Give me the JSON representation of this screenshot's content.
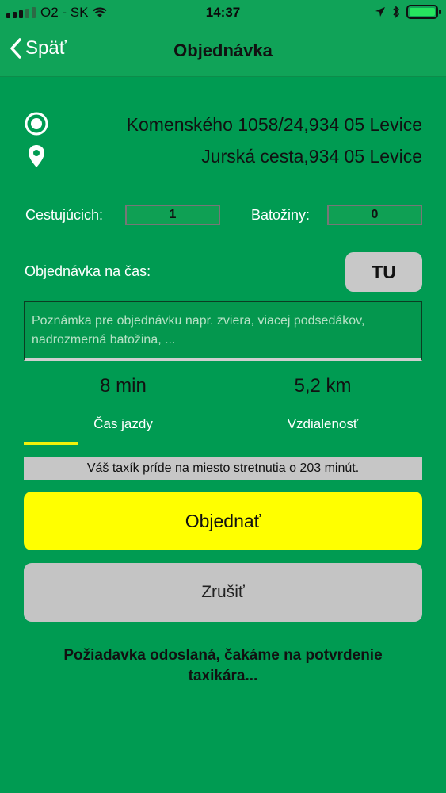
{
  "status_bar": {
    "carrier": "O2 - SK",
    "time": "14:37"
  },
  "nav": {
    "back_label": "Späť",
    "title": "Objednávka"
  },
  "route": {
    "from": "Komenského 1058/24,934 05 Levice",
    "to": "Jurská cesta,934 05 Levice"
  },
  "counts": {
    "passengers_label": "Cestujúcich:",
    "passengers_value": "1",
    "luggage_label": "Batožiny:",
    "luggage_value": "0"
  },
  "time_order": {
    "label": "Objednávka na čas:",
    "button": "TU"
  },
  "note": {
    "placeholder": "Poznámka pre objednávku napr. zviera, viacej podsedákov, nadrozmerná batožina, ..."
  },
  "stats": {
    "duration_value": "8 min",
    "duration_label": "Čas jazdy",
    "distance_value": "5,2 km",
    "distance_label": "Vzdialenosť"
  },
  "info_text": "Váš taxík príde na miesto stretnutia o 203 minút.",
  "buttons": {
    "order": "Objednať",
    "cancel": "Zrušiť"
  },
  "status_message": "Požiadavka odoslaná, čakáme na potvrdenie taxikára...",
  "colors": {
    "background": "#009b52",
    "order_button": "#ffff00",
    "cancel_button": "#c4c4c4",
    "accent_indicator": "#f0f20a"
  }
}
